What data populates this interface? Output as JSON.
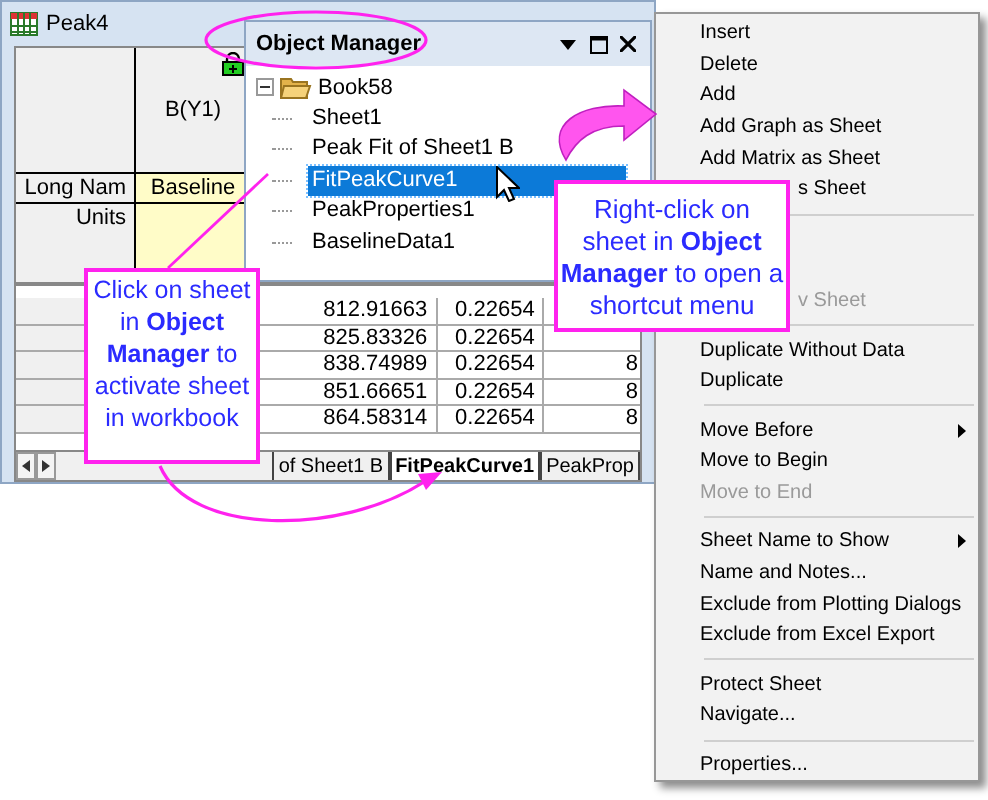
{
  "workbook": {
    "title": "Peak4",
    "column_header": "B(Y1)",
    "row_labels": [
      "Long Nam",
      "Units"
    ],
    "long_name": "Baseline",
    "rows": [
      [
        "812.91663",
        "0.22654"
      ],
      [
        "825.83326",
        "0.22654"
      ],
      [
        "838.74989",
        "0.22654",
        "8"
      ],
      [
        "851.66651",
        "0.22654",
        "8"
      ],
      [
        "864.58314",
        "0.22654",
        "8"
      ]
    ],
    "tabs": [
      {
        "label": "of Sheet1 B",
        "selected": false
      },
      {
        "label": "FitPeakCurve1",
        "selected": true
      },
      {
        "label": "PeakProp",
        "selected": false
      }
    ]
  },
  "object_manager": {
    "title": "Object Manager",
    "tree": [
      {
        "label": "Book58",
        "expanded": true,
        "children": [
          {
            "label": "Sheet1",
            "selected": false
          },
          {
            "label": "Peak Fit of Sheet1 B",
            "selected": false
          },
          {
            "label": "FitPeakCurve1",
            "selected": true
          },
          {
            "label": "PeakProperties1",
            "selected": false
          },
          {
            "label": "BaselineData1",
            "selected": false
          }
        ]
      }
    ]
  },
  "context_menu": {
    "items": [
      {
        "kind": "item",
        "label": "Insert",
        "disabled": false
      },
      {
        "kind": "item",
        "label": "Delete",
        "disabled": false
      },
      {
        "kind": "item",
        "label": "Add",
        "disabled": false
      },
      {
        "kind": "item",
        "label": "Add Graph as Sheet",
        "disabled": false
      },
      {
        "kind": "item",
        "label": "Add Matrix as Sheet",
        "disabled": false
      },
      {
        "kind": "partial",
        "label": "s Sheet",
        "disabled": false
      },
      {
        "kind": "separator"
      },
      {
        "kind": "covered"
      },
      {
        "kind": "covered"
      },
      {
        "kind": "partial",
        "label": "v Sheet",
        "disabled": true
      },
      {
        "kind": "separator"
      },
      {
        "kind": "item",
        "label": "Duplicate Without Data",
        "disabled": false
      },
      {
        "kind": "item",
        "label": "Duplicate",
        "disabled": false
      },
      {
        "kind": "separator"
      },
      {
        "kind": "submenu",
        "label": "Move Before",
        "disabled": false
      },
      {
        "kind": "item",
        "label": "Move to Begin",
        "disabled": false
      },
      {
        "kind": "item",
        "label": "Move to End",
        "disabled": true
      },
      {
        "kind": "separator"
      },
      {
        "kind": "submenu",
        "label": "Sheet Name to Show",
        "disabled": false
      },
      {
        "kind": "item",
        "label": "Name and Notes...",
        "disabled": false
      },
      {
        "kind": "item",
        "label": "Exclude from Plotting Dialogs",
        "disabled": false
      },
      {
        "kind": "item",
        "label": "Exclude from Excel Export",
        "disabled": false
      },
      {
        "kind": "separator"
      },
      {
        "kind": "item",
        "label": "Protect Sheet",
        "disabled": false
      },
      {
        "kind": "item",
        "label": "Navigate...",
        "disabled": false
      },
      {
        "kind": "separator"
      },
      {
        "kind": "item",
        "label": "Properties...",
        "disabled": false
      }
    ]
  },
  "callouts": [
    {
      "text": "Click on sheet in **Object Manager** to activate sheet in workbook"
    },
    {
      "text": "Right-click on sheet in **Object Manager** to open a shortcut menu"
    }
  ]
}
